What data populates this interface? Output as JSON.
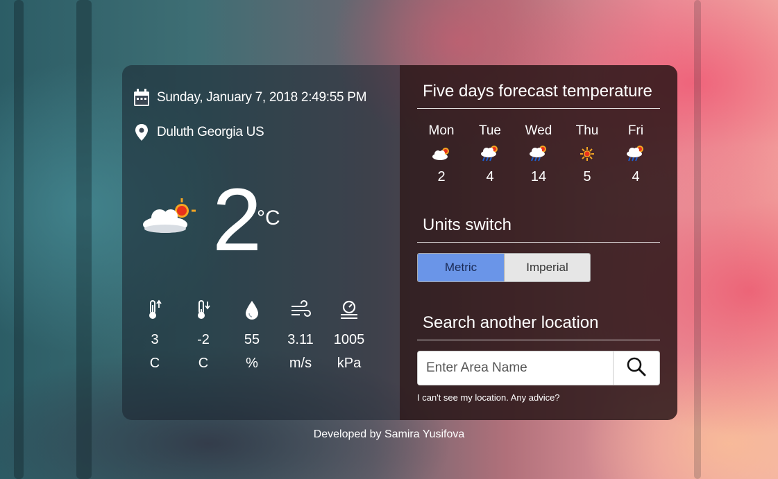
{
  "current": {
    "datetime": "Sunday, January 7, 2018 2:49:55 PM",
    "location": "Duluth Georgia US",
    "temperature": "2",
    "unit": "°C",
    "condition_icon": "cloud-sun-icon"
  },
  "stats": [
    {
      "icon": "thermometer-up-icon",
      "value": "3",
      "unit": "C"
    },
    {
      "icon": "thermometer-down-icon",
      "value": "-2",
      "unit": "C"
    },
    {
      "icon": "humidity-drop-icon",
      "value": "55",
      "unit": "%"
    },
    {
      "icon": "wind-icon",
      "value": "3.11",
      "unit": "m/s"
    },
    {
      "icon": "pressure-gauge-icon",
      "value": "1005",
      "unit": "kPa"
    }
  ],
  "forecast": {
    "title": "Five days forecast temperature",
    "days": [
      {
        "name": "Mon",
        "icon": "cloud-sun-icon",
        "temp": "2"
      },
      {
        "name": "Tue",
        "icon": "rain-cloud-sun-icon",
        "temp": "4"
      },
      {
        "name": "Wed",
        "icon": "rain-cloud-sun-icon",
        "temp": "14"
      },
      {
        "name": "Thu",
        "icon": "sun-icon",
        "temp": "5"
      },
      {
        "name": "Fri",
        "icon": "rain-cloud-sun-icon",
        "temp": "4"
      }
    ]
  },
  "units": {
    "title": "Units switch",
    "metric_label": "Metric",
    "imperial_label": "Imperial",
    "selected": "Metric",
    "active_color": "#6a95e8"
  },
  "search": {
    "title": "Search another location",
    "placeholder": "Enter Area Name",
    "value": "",
    "button_icon": "search-icon",
    "advice_link": "I can't see my location. Any advice?"
  },
  "footer": {
    "credit": "Developed by Samira Yusifova"
  }
}
